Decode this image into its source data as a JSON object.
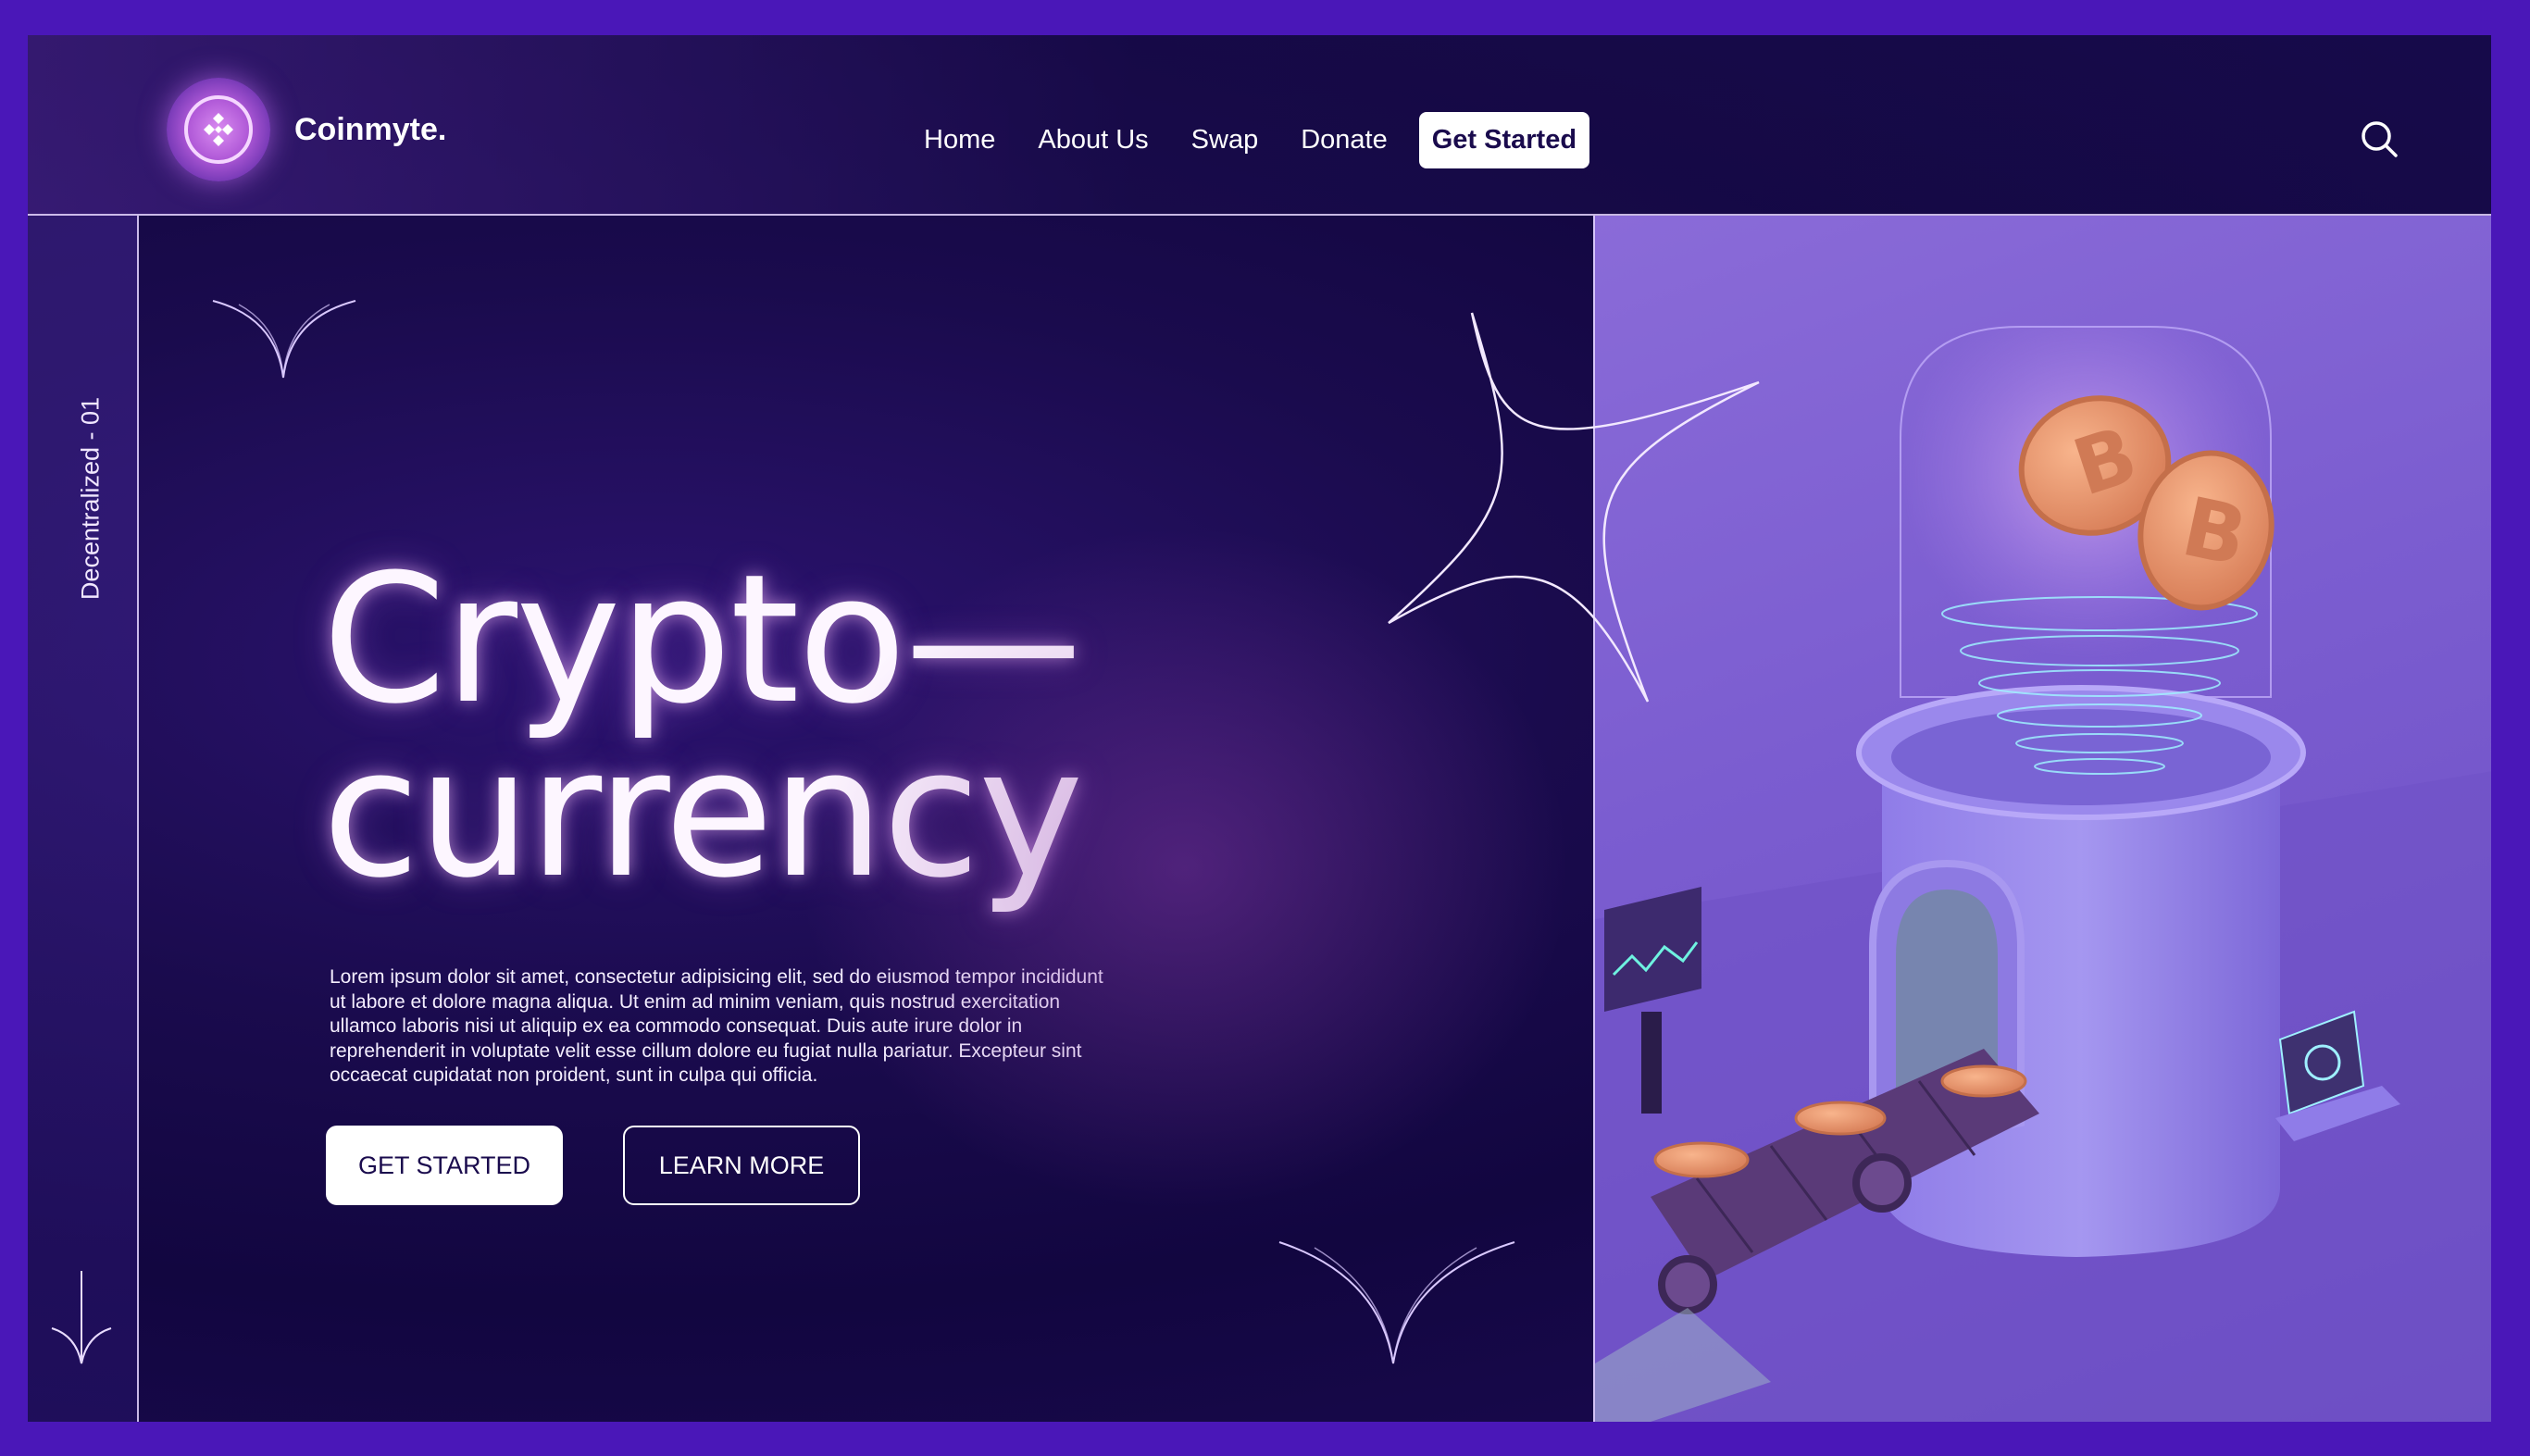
{
  "brand": {
    "name": "Coinmyte."
  },
  "nav": {
    "items": [
      "Home",
      "About Us",
      "Swap",
      "Donate"
    ],
    "cta": "Get Started"
  },
  "rail": {
    "label": "Decentralized - 01"
  },
  "hero": {
    "title_line1": "Crypto—",
    "title_line2": "currency",
    "body": "Lorem ipsum dolor sit amet, consectetur adipisicing elit, sed do eiusmod tempor incididunt ut labore et dolore magna aliqua. Ut enim ad minim veniam, quis nostrud exercitation ullamco laboris nisi ut aliquip ex ea commodo consequat. Duis aute irure dolor in reprehenderit in voluptate velit esse cillum dolore eu fugiat nulla pariatur. Excepteur sint occaecat cupidatat non proident, sunt in culpa qui officia.",
    "primary_button": "GET STARTED",
    "secondary_button": "LEARN MORE"
  },
  "colors": {
    "page_border": "#4a17b8",
    "background": "#1a0b4d",
    "panel": "#7b5dd0",
    "coin": "#e8946a",
    "accent_glow": "#d98bf0"
  },
  "icons": {
    "logo": "binance-diamond-icon",
    "search": "search-icon",
    "scroll": "arrow-down-icon"
  }
}
